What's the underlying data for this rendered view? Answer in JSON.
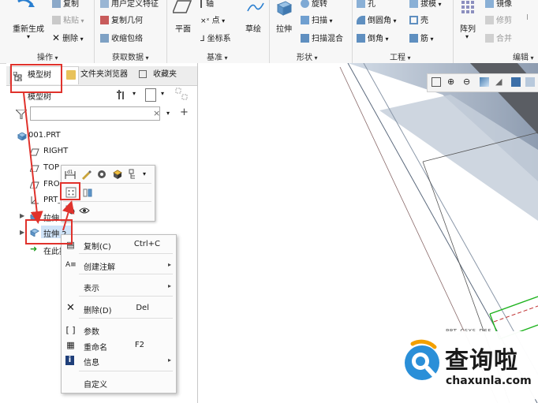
{
  "ribbon": {
    "g1": {
      "top_a": "复制",
      "top_b": "粘贴",
      "big": "重新生成",
      "delete": "删除"
    },
    "g2": {
      "top": "用户定义特征",
      "copy_geom": "复制几何",
      "shrinkwrap": "收缩包络"
    },
    "g3": {
      "plane": "平面",
      "top": "轴",
      "point": "点",
      "csys": "坐标系",
      "sketch": "草绘"
    },
    "g4": {
      "extrude": "拉伸",
      "top": "旋转",
      "sweep": "扫描",
      "swept_blend": "扫描混合"
    },
    "g5": {
      "top_a": "孔",
      "top_b": "拔模",
      "round": "倒圆角",
      "chamfer": "倒角",
      "shell": "壳",
      "rib": "筋"
    },
    "g6": {
      "pattern": "阵列",
      "top": "镜像",
      "trim": "修剪",
      "merge": "合并",
      "extra": "Ⅰ"
    },
    "groups": [
      "操作",
      "获取数据",
      "基准",
      "形状",
      "工程",
      "编辑"
    ]
  },
  "left_panel": {
    "tabs": [
      "模型树",
      "文件夹浏览器",
      "收藏夹"
    ],
    "tree_title": "模型树",
    "filter_placeholder": "",
    "clear_symbol": "×",
    "add_symbol": "+",
    "tree": [
      {
        "label": "001.PRT"
      },
      {
        "label": "RIGHT"
      },
      {
        "label": "TOP"
      },
      {
        "label": "FRONT"
      },
      {
        "label": "PRT_CSYS_DEF"
      },
      {
        "label": "拉伸 1"
      },
      {
        "label": "拉伸 2"
      },
      {
        "label": "在此插入"
      }
    ]
  },
  "context_menu": {
    "items": [
      {
        "label": "复制(C)",
        "shortcut": "Ctrl+C"
      },
      {
        "label": "创建注解",
        "submenu": "▸"
      },
      {
        "label": "表示",
        "submenu": "▸"
      },
      {
        "label": "删除(D)",
        "shortcut": "Del"
      },
      {
        "label": "参数"
      },
      {
        "label": "重命名",
        "shortcut": "F2"
      },
      {
        "label": "信息",
        "submenu": "▸"
      },
      {
        "label": "自定义"
      }
    ]
  },
  "graphics": {
    "label": "PRT_CSYS_DEF"
  },
  "logo": {
    "title": "查询啦",
    "subtitle": "chaxunla.com"
  },
  "colors": {
    "highlight_red": "#e0322c",
    "selection_blue": "#cfe3f7",
    "logo_blue": "#2a8fd8",
    "green": "#00b000"
  }
}
